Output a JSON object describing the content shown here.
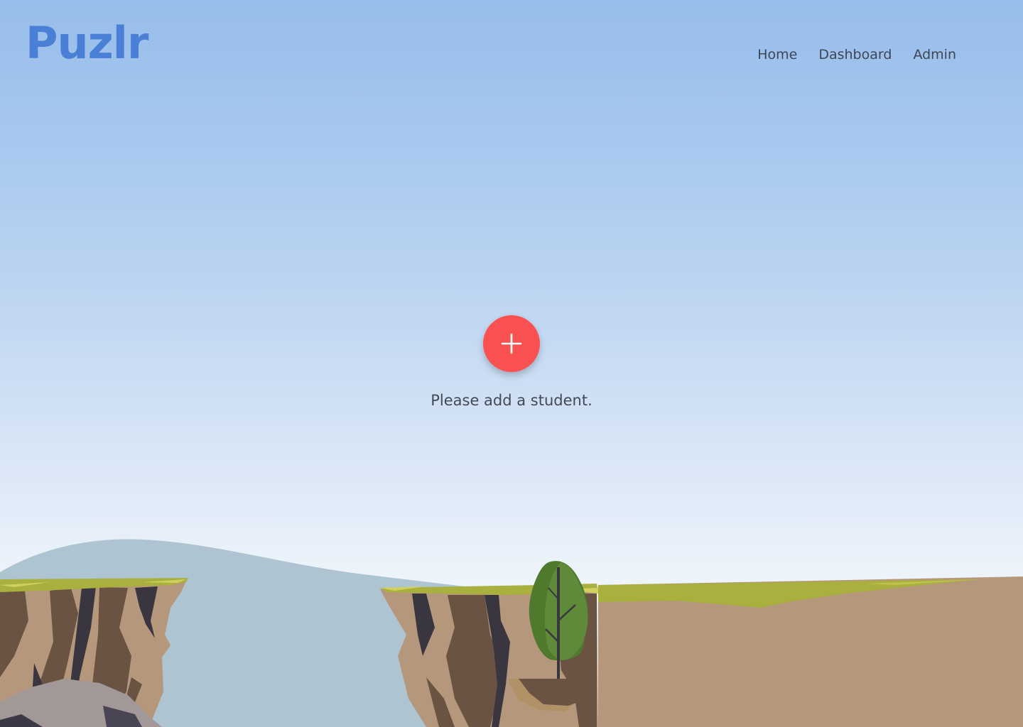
{
  "app": {
    "logo": "Puzlr"
  },
  "nav": {
    "items": [
      {
        "label": "Home"
      },
      {
        "label": "Dashboard"
      },
      {
        "label": "Admin"
      }
    ]
  },
  "main": {
    "add_button_icon": "plus-icon",
    "empty_message": "Please add a student."
  },
  "colors": {
    "brand": "#4a7fd6",
    "accent": "#f95152",
    "sky_top": "#97bdea",
    "sky_bottom": "#f3f7fc"
  }
}
